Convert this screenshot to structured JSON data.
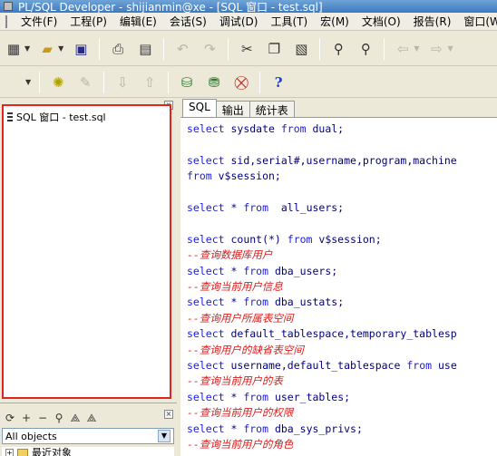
{
  "titlebar": {
    "title": "PL/SQL Developer - shijianmin@xe - [SQL 窗口 - test.sql]"
  },
  "menu": [
    "文件(F)",
    "工程(P)",
    "编辑(E)",
    "会话(S)",
    "调试(D)",
    "工具(T)",
    "宏(M)",
    "文档(O)",
    "报告(R)",
    "窗口(W)"
  ],
  "left_panel": {
    "windows_list": [
      {
        "label": "SQL 窗口 - test.sql"
      }
    ],
    "object_filter": "All objects",
    "tree_first_item": "最近对象"
  },
  "editor": {
    "tabs": [
      "SQL",
      "输出",
      "统计表"
    ],
    "active_tab": "SQL",
    "lines": [
      {
        "type": "code",
        "parts": [
          [
            "kw",
            "select "
          ],
          [
            "id",
            "sysdate "
          ],
          [
            "kw",
            "from "
          ],
          [
            "id",
            "dual;"
          ]
        ]
      },
      {
        "type": "blank"
      },
      {
        "type": "code",
        "parts": [
          [
            "kw",
            "select "
          ],
          [
            "id",
            "sid,serial#,username,program,machine"
          ]
        ]
      },
      {
        "type": "code",
        "parts": [
          [
            "kw",
            "from "
          ],
          [
            "id",
            "v$session;"
          ]
        ]
      },
      {
        "type": "blank"
      },
      {
        "type": "code",
        "parts": [
          [
            "kw",
            "select "
          ],
          [
            "id",
            "* "
          ],
          [
            "kw",
            "from  "
          ],
          [
            "id",
            "all_users;"
          ]
        ]
      },
      {
        "type": "blank"
      },
      {
        "type": "code",
        "parts": [
          [
            "kw",
            "select "
          ],
          [
            "id",
            "count(*) "
          ],
          [
            "kw",
            "from "
          ],
          [
            "id",
            "v$session;"
          ]
        ]
      },
      {
        "type": "comment",
        "text": "--查询数据库用户"
      },
      {
        "type": "code",
        "parts": [
          [
            "kw",
            "select "
          ],
          [
            "id",
            "* "
          ],
          [
            "kw",
            "from "
          ],
          [
            "id",
            "dba_users;"
          ]
        ]
      },
      {
        "type": "comment",
        "text": "--查询当前用户信息"
      },
      {
        "type": "code",
        "parts": [
          [
            "kw",
            "select "
          ],
          [
            "id",
            "* "
          ],
          [
            "kw",
            "from "
          ],
          [
            "id",
            "dba_ustats;"
          ]
        ]
      },
      {
        "type": "comment",
        "text": "--查询用户所属表空间"
      },
      {
        "type": "code",
        "parts": [
          [
            "kw",
            "select "
          ],
          [
            "id",
            "default_tablespace,temporary_tablesp"
          ]
        ]
      },
      {
        "type": "comment",
        "text": "--查询用户的缺省表空间"
      },
      {
        "type": "code",
        "parts": [
          [
            "kw",
            "select "
          ],
          [
            "id",
            "username,default_tablespace "
          ],
          [
            "kw",
            "from "
          ],
          [
            "id",
            "use"
          ]
        ]
      },
      {
        "type": "comment",
        "text": "--查询当前用户的表"
      },
      {
        "type": "code",
        "parts": [
          [
            "kw",
            "select "
          ],
          [
            "id",
            "* "
          ],
          [
            "kw",
            "from "
          ],
          [
            "id",
            "user_tables;"
          ]
        ]
      },
      {
        "type": "comment",
        "text": "--查询当前用户的权限"
      },
      {
        "type": "code",
        "parts": [
          [
            "kw",
            "select "
          ],
          [
            "id",
            "* "
          ],
          [
            "kw",
            "from "
          ],
          [
            "id",
            "dba_sys_privs;"
          ]
        ]
      },
      {
        "type": "comment",
        "text": "--查询当前用户的角色"
      }
    ]
  },
  "toolbar1_icons": [
    "new-icon",
    "open-icon",
    "save-icon",
    "print-icon",
    "print-setup-icon",
    "undo-icon",
    "redo-icon",
    "cut-icon",
    "copy-icon",
    "paste-icon",
    "find-icon",
    "find-next-icon",
    "back-icon",
    "forward-icon"
  ],
  "toolbar2_icons": [
    "compile-icon",
    "debug-disabled-icon",
    "import-disabled-icon",
    "export-disabled-icon",
    "sql-window-icon",
    "sql-tables-icon",
    "remove-db-icon",
    "help-icon"
  ]
}
